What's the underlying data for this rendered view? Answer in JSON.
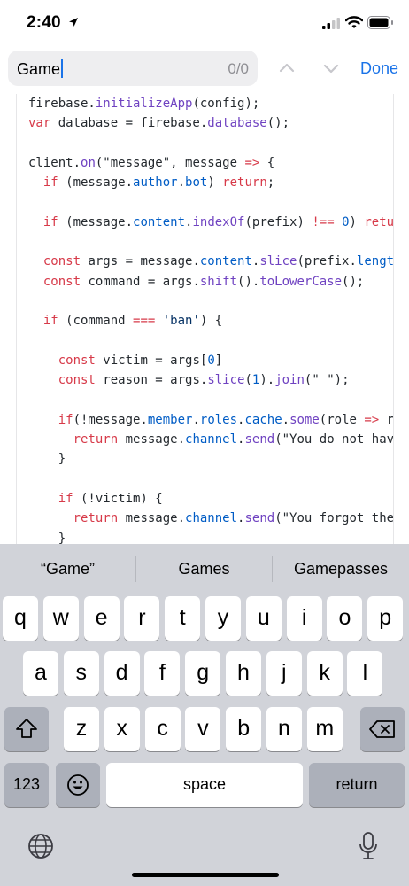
{
  "status": {
    "time": "2:40"
  },
  "find": {
    "query": "Game",
    "count": "0/0",
    "done_label": "Done"
  },
  "code": [
    [
      [
        "plain",
        "firebase."
      ],
      [
        "fn",
        "initializeApp"
      ],
      [
        "plain",
        "(config);"
      ]
    ],
    [
      [
        "kw",
        "var "
      ],
      [
        "plain",
        "database = firebase."
      ],
      [
        "fn",
        "database"
      ],
      [
        "plain",
        "();"
      ]
    ],
    [],
    [
      [
        "plain",
        "client."
      ],
      [
        "fn",
        "on"
      ],
      [
        "plain",
        "(\"message\", message "
      ],
      [
        "kw",
        "=>"
      ],
      [
        "plain",
        " {"
      ]
    ],
    [
      [
        "plain",
        "  "
      ],
      [
        "kw",
        "if"
      ],
      [
        "plain",
        " (message."
      ],
      [
        "prop",
        "author"
      ],
      [
        "plain",
        "."
      ],
      [
        "prop",
        "bot"
      ],
      [
        "plain",
        ") "
      ],
      [
        "kw",
        "return"
      ],
      [
        "plain",
        ";"
      ]
    ],
    [],
    [
      [
        "plain",
        "  "
      ],
      [
        "kw",
        "if"
      ],
      [
        "plain",
        " (message."
      ],
      [
        "prop",
        "content"
      ],
      [
        "plain",
        "."
      ],
      [
        "fn",
        "indexOf"
      ],
      [
        "plain",
        "(prefix) "
      ],
      [
        "kw",
        "!=="
      ],
      [
        "plain",
        " "
      ],
      [
        "num",
        "0"
      ],
      [
        "plain",
        ") "
      ],
      [
        "kw",
        "return"
      ]
    ],
    [],
    [
      [
        "plain",
        "  "
      ],
      [
        "kw",
        "const"
      ],
      [
        "plain",
        " args = message."
      ],
      [
        "prop",
        "content"
      ],
      [
        "plain",
        "."
      ],
      [
        "fn",
        "slice"
      ],
      [
        "plain",
        "(prefix."
      ],
      [
        "prop",
        "length"
      ],
      [
        "plain",
        ")"
      ]
    ],
    [
      [
        "plain",
        "  "
      ],
      [
        "kw",
        "const"
      ],
      [
        "plain",
        " command = args."
      ],
      [
        "fn",
        "shift"
      ],
      [
        "plain",
        "()."
      ],
      [
        "fn",
        "toLowerCase"
      ],
      [
        "plain",
        "();"
      ]
    ],
    [],
    [
      [
        "plain",
        "  "
      ],
      [
        "kw",
        "if"
      ],
      [
        "plain",
        " (command "
      ],
      [
        "kw",
        "==="
      ],
      [
        "plain",
        " "
      ],
      [
        "str",
        "'ban'"
      ],
      [
        "plain",
        ") {"
      ]
    ],
    [],
    [
      [
        "plain",
        "    "
      ],
      [
        "kw",
        "const"
      ],
      [
        "plain",
        " victim = args["
      ],
      [
        "num",
        "0"
      ],
      [
        "plain",
        "]"
      ]
    ],
    [
      [
        "plain",
        "    "
      ],
      [
        "kw",
        "const"
      ],
      [
        "plain",
        " reason = args."
      ],
      [
        "fn",
        "slice"
      ],
      [
        "plain",
        "("
      ],
      [
        "num",
        "1"
      ],
      [
        "plain",
        ")."
      ],
      [
        "fn",
        "join"
      ],
      [
        "plain",
        "(\" \");"
      ]
    ],
    [],
    [
      [
        "plain",
        "    "
      ],
      [
        "kw",
        "if"
      ],
      [
        "plain",
        "(!message."
      ],
      [
        "prop",
        "member"
      ],
      [
        "plain",
        "."
      ],
      [
        "prop",
        "roles"
      ],
      [
        "plain",
        "."
      ],
      [
        "prop",
        "cache"
      ],
      [
        "plain",
        "."
      ],
      [
        "fn",
        "some"
      ],
      [
        "plain",
        "(role "
      ],
      [
        "kw",
        "=>"
      ],
      [
        "plain",
        " rol"
      ]
    ],
    [
      [
        "plain",
        "      "
      ],
      [
        "kw",
        "return"
      ],
      [
        "plain",
        " message."
      ],
      [
        "prop",
        "channel"
      ],
      [
        "plain",
        "."
      ],
      [
        "fn",
        "send"
      ],
      [
        "plain",
        "(\"You do not have"
      ]
    ],
    [
      [
        "plain",
        "    }"
      ]
    ],
    [],
    [
      [
        "plain",
        "    "
      ],
      [
        "kw",
        "if"
      ],
      [
        "plain",
        " (!victim) {"
      ]
    ],
    [
      [
        "plain",
        "      "
      ],
      [
        "kw",
        "return"
      ],
      [
        "plain",
        " message."
      ],
      [
        "prop",
        "channel"
      ],
      [
        "plain",
        "."
      ],
      [
        "fn",
        "send"
      ],
      [
        "plain",
        "(\"You forgot the u"
      ]
    ],
    [
      [
        "plain",
        "    }"
      ]
    ]
  ],
  "keyboard": {
    "suggestions": [
      "“Game”",
      "Games",
      "Gamepasses"
    ],
    "row1": [
      "q",
      "w",
      "e",
      "r",
      "t",
      "y",
      "u",
      "i",
      "o",
      "p"
    ],
    "row2": [
      "a",
      "s",
      "d",
      "f",
      "g",
      "h",
      "j",
      "k",
      "l"
    ],
    "row3": [
      "z",
      "x",
      "c",
      "v",
      "b",
      "n",
      "m"
    ],
    "numbers_label": "123",
    "space_label": "space",
    "return_label": "return"
  },
  "icons": {
    "location": "location-arrow-icon",
    "cellular": "cellular-signal-icon",
    "wifi": "wifi-icon",
    "battery": "battery-icon",
    "up": "chevron-up-icon",
    "down": "chevron-down-icon",
    "shift": "shift-icon",
    "delete": "backspace-icon",
    "emoji": "emoji-icon",
    "globe": "globe-icon",
    "mic": "microphone-icon"
  },
  "colors": {
    "accent": "#1a73e8",
    "keyword": "#d73a49",
    "function": "#6f42c1",
    "property": "#005cc5"
  }
}
